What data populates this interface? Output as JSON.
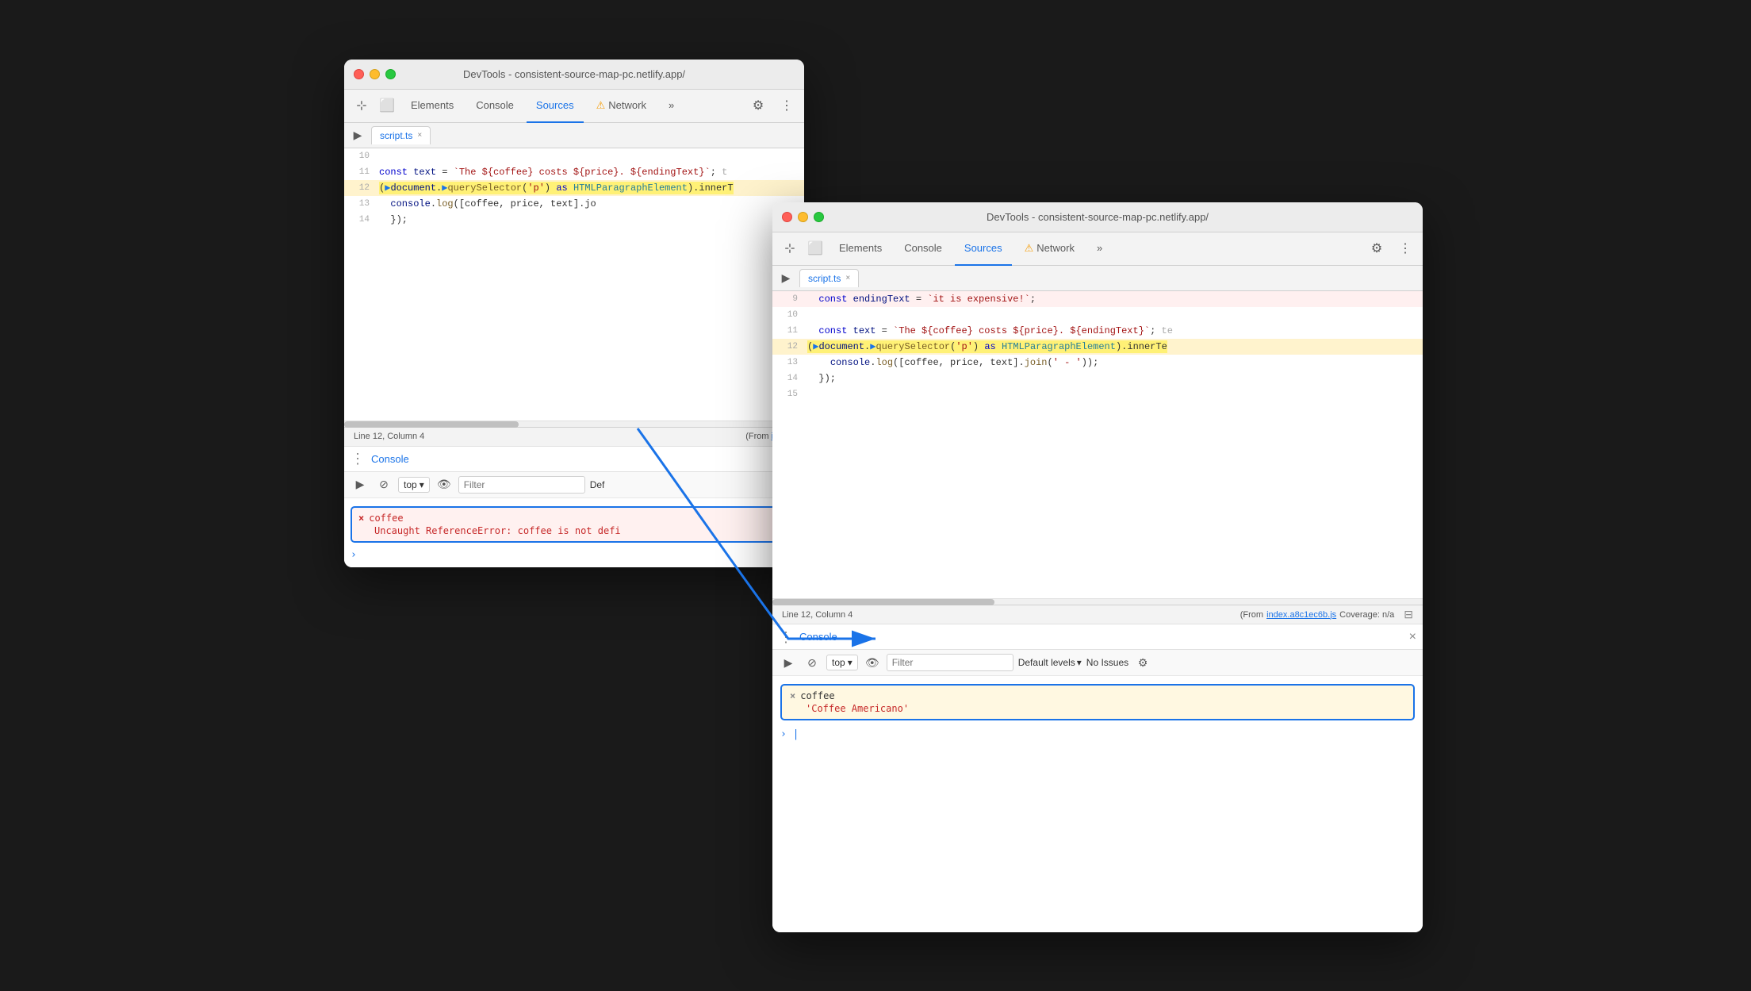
{
  "scene": {
    "background": "#1a1a1a"
  },
  "window_back": {
    "titlebar": {
      "title": "DevTools - consistent-source-map-pc.netlify.app/"
    },
    "toolbar": {
      "tabs": [
        "Elements",
        "Console",
        "Sources",
        "Network"
      ],
      "active_tab": "Sources"
    },
    "file_tab": {
      "name": "script.ts"
    },
    "code_lines": [
      {
        "num": 10,
        "content": ""
      },
      {
        "num": 11,
        "content": "  const text = `The ${coffee} costs ${price}. ${endingText}`;  t"
      },
      {
        "num": 12,
        "content": "  (▶document.▶querySelector('p') as HTMLParagraphElement).innerT",
        "highlighted": true
      },
      {
        "num": 13,
        "content": "  console.log([coffee, price, text].jo"
      },
      {
        "num": 14,
        "content": "  });"
      }
    ],
    "status": {
      "position": "Line 12, Column 4",
      "from_text": "(From index.",
      "link": "index"
    },
    "console": {
      "title": "Console",
      "toolbar": {
        "top_label": "top",
        "filter_placeholder": "Filter",
        "default_levels": "Def"
      },
      "error": {
        "label": "coffee",
        "message": "Uncaught ReferenceError: coffee is not defi"
      }
    }
  },
  "window_front": {
    "titlebar": {
      "title": "DevTools - consistent-source-map-pc.netlify.app/"
    },
    "toolbar": {
      "tabs": [
        "Elements",
        "Console",
        "Sources",
        "Network"
      ],
      "active_tab": "Sources"
    },
    "file_tab": {
      "name": "script.ts"
    },
    "code_lines": [
      {
        "num": 9,
        "content": "  const endingText = `it is expensive!`;"
      },
      {
        "num": 10,
        "content": ""
      },
      {
        "num": 11,
        "content": "  const text = `The ${coffee} costs ${price}. ${endingText}`;  te"
      },
      {
        "num": 12,
        "content": "  (▶document.▶querySelector('p') as HTMLParagraphElement).innerTe",
        "highlighted": true
      },
      {
        "num": 13,
        "content": "    console.log([coffee, price, text].join(' - '));"
      },
      {
        "num": 14,
        "content": "  });"
      },
      {
        "num": 15,
        "content": ""
      }
    ],
    "status": {
      "position": "Line 12, Column 4",
      "from_text": "(From ",
      "link": "index.a8c1ec6b.js",
      "coverage": "Coverage: n/a"
    },
    "console": {
      "title": "Console",
      "toolbar": {
        "top_label": "top",
        "filter_placeholder": "Filter",
        "default_levels": "Default levels",
        "no_issues": "No Issues"
      },
      "log": {
        "label": "coffee",
        "value": "'Coffee Americano'"
      }
    }
  },
  "icons": {
    "cursor": "⊹",
    "device": "⬜",
    "settings": "⚙",
    "more": "⋮",
    "sidebar": "▶",
    "clear": "⊘",
    "eye": "👁",
    "chevron_down": "▾",
    "close": "×",
    "error_x": "×",
    "prompt": ">",
    "breakpoint": "●"
  }
}
